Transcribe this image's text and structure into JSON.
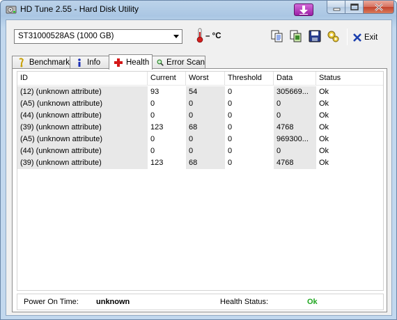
{
  "window": {
    "title": "HD Tune 2.55 - Hard Disk Utility"
  },
  "toolbar": {
    "drive": "ST31000528AS (1000 GB)",
    "temperature": "– °C",
    "exit_label": "Exit",
    "icons": [
      "copy-text-icon",
      "copy-screenshot-icon",
      "save-icon",
      "options-icon",
      "exit-icon"
    ]
  },
  "tabs": [
    {
      "label": "Benchmark",
      "icon": "benchmark-icon"
    },
    {
      "label": "Info",
      "icon": "info-icon"
    },
    {
      "label": "Health",
      "icon": "health-cross-icon",
      "active": true
    },
    {
      "label": "Error Scan",
      "icon": "magnifier-icon"
    }
  ],
  "table": {
    "columns": [
      "ID",
      "Current",
      "Worst",
      "Threshold",
      "Data",
      "Status"
    ],
    "rows": [
      [
        "(12) (unknown attribute)",
        "93",
        "54",
        "0",
        "305669...",
        "Ok"
      ],
      [
        "(A5) (unknown attribute)",
        "0",
        "0",
        "0",
        "0",
        "Ok"
      ],
      [
        "(44) (unknown attribute)",
        "0",
        "0",
        "0",
        "0",
        "Ok"
      ],
      [
        "(39) (unknown attribute)",
        "123",
        "68",
        "0",
        "4768",
        "Ok"
      ],
      [
        "(A5) (unknown attribute)",
        "0",
        "0",
        "0",
        "969300...",
        "Ok"
      ],
      [
        "(44) (unknown attribute)",
        "0",
        "0",
        "0",
        "0",
        "Ok"
      ],
      [
        "(39) (unknown attribute)",
        "123",
        "68",
        "0",
        "4768",
        "Ok"
      ]
    ]
  },
  "footer": {
    "power_on_label": "Power On Time:",
    "power_on_value": "unknown",
    "health_label": "Health Status:",
    "health_value": "Ok",
    "health_color": "#1fa61f"
  }
}
